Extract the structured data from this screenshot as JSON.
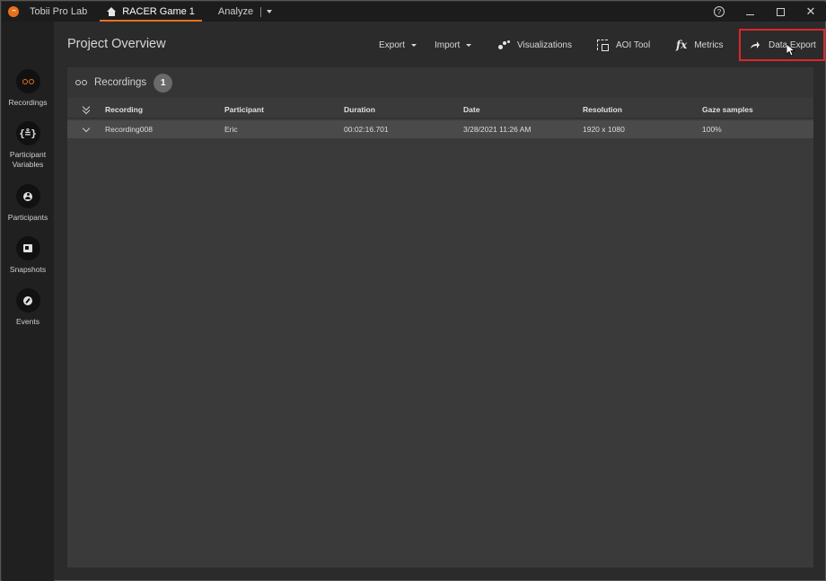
{
  "titlebar": {
    "app_name": "Tobii Pro Lab",
    "project_tab": "RACER Game 1",
    "analyze_tab": "Analyze",
    "help_symbol": "?",
    "close_symbol": "✕"
  },
  "sidebar": {
    "items": [
      {
        "label": "Recordings",
        "icon": "recordings-icon"
      },
      {
        "label": "Participant Variables",
        "icon": "participant-variables-icon"
      },
      {
        "label": "Participants",
        "icon": "participants-icon"
      },
      {
        "label": "Snapshots",
        "icon": "snapshots-icon"
      },
      {
        "label": "Events",
        "icon": "events-icon"
      }
    ],
    "pv_glyph": "{≗}"
  },
  "header": {
    "title": "Project Overview",
    "toolbar": {
      "export": "Export",
      "import": "Import",
      "visualizations": "Visualizations",
      "aoi_tool": "AOI Tool",
      "metrics_icon": "fx",
      "metrics": "Metrics",
      "data_export": "Data Export"
    }
  },
  "recordings_panel": {
    "title": "Recordings",
    "count": "1",
    "columns": [
      "Recording",
      "Participant",
      "Duration",
      "Date",
      "Resolution",
      "Gaze samples"
    ],
    "rows": [
      [
        "Recording008",
        "Eric",
        "00:02:16.701",
        "3/28/2021 11:26 AM",
        "1920 x 1080",
        "100%"
      ]
    ]
  },
  "colors": {
    "accent": "#e8701c",
    "highlight": "#e0242a"
  }
}
